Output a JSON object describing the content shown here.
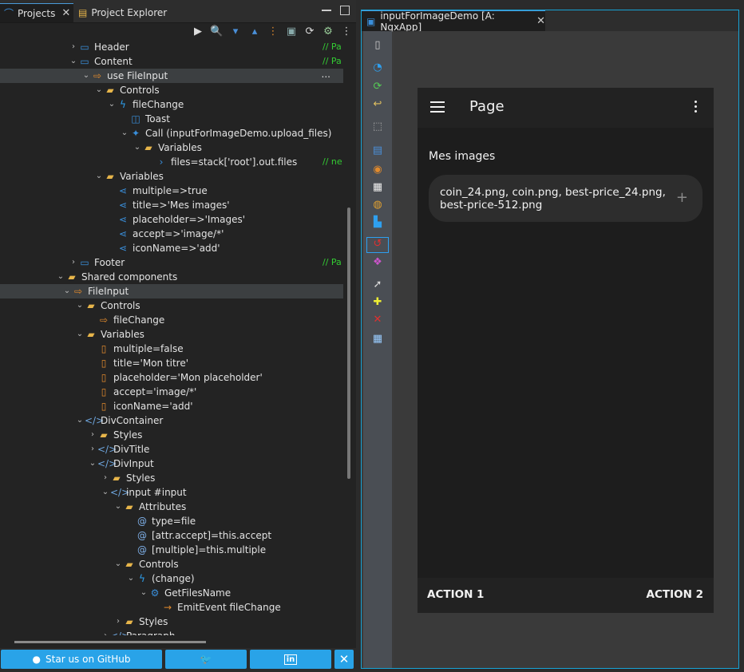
{
  "left_tabs": [
    {
      "label": "Projects",
      "active": true
    },
    {
      "label": "Project Explorer",
      "active": false
    }
  ],
  "tree": [
    {
      "indent": 0,
      "arrow": "›",
      "icon": "page-icon",
      "label": "Header",
      "comment": "// Pa"
    },
    {
      "indent": 0,
      "arrow": "⌄",
      "icon": "page-icon",
      "label": "Content",
      "comment": "// Pa"
    },
    {
      "indent": 1,
      "arrow": "⌄",
      "icon": "use-component-icon",
      "label": "use FileInput",
      "selected": true,
      "more": "..."
    },
    {
      "indent": 2,
      "arrow": "⌄",
      "icon": "folder-icon",
      "label": "Controls"
    },
    {
      "indent": 3,
      "arrow": "⌄",
      "icon": "event-icon",
      "label": "fileChange"
    },
    {
      "indent": 4,
      "arrow": "",
      "icon": "toast-icon",
      "label": "Toast"
    },
    {
      "indent": 4,
      "arrow": "⌄",
      "icon": "call-icon",
      "label": "Call (inputForImageDemo.upload_files)"
    },
    {
      "indent": 5,
      "arrow": "⌄",
      "icon": "folder-icon",
      "label": "Variables"
    },
    {
      "indent": 6,
      "arrow": "",
      "icon": "chevron-icon",
      "label": "files=stack['root'].out.files",
      "comment": "// ne"
    },
    {
      "indent": 2,
      "arrow": "⌄",
      "icon": "folder-icon",
      "label": "Variables"
    },
    {
      "indent": 3,
      "arrow": "",
      "icon": "share-icon",
      "label": "multiple=>true"
    },
    {
      "indent": 3,
      "arrow": "",
      "icon": "share-icon",
      "label": "title=>'Mes images'"
    },
    {
      "indent": 3,
      "arrow": "",
      "icon": "share-icon",
      "label": "placeholder=>'Images'"
    },
    {
      "indent": 3,
      "arrow": "",
      "icon": "share-icon",
      "label": "accept=>'image/*'"
    },
    {
      "indent": 3,
      "arrow": "",
      "icon": "share-icon",
      "label": "iconName=>'add'"
    },
    {
      "indent": 0,
      "arrow": "›",
      "icon": "page-icon",
      "label": "Footer",
      "comment": "// Pa"
    },
    {
      "indent": -1,
      "arrow": "⌄",
      "icon": "folder-icon",
      "label": "Shared components"
    },
    {
      "indent": -0.5,
      "arrow": "⌄",
      "icon": "component-icon",
      "label": "FileInput",
      "selected": true
    },
    {
      "indent": 0.5,
      "arrow": "⌄",
      "icon": "folder-icon",
      "label": "Controls"
    },
    {
      "indent": 1.5,
      "arrow": "",
      "icon": "event-out-icon",
      "label": "fileChange"
    },
    {
      "indent": 0.5,
      "arrow": "⌄",
      "icon": "folder-icon",
      "label": "Variables"
    },
    {
      "indent": 1.5,
      "arrow": "",
      "icon": "variable-icon",
      "label": "multiple=false"
    },
    {
      "indent": 1.5,
      "arrow": "",
      "icon": "variable-icon",
      "label": "title='Mon titre'"
    },
    {
      "indent": 1.5,
      "arrow": "",
      "icon": "variable-icon",
      "label": "placeholder='Mon placeholder'"
    },
    {
      "indent": 1.5,
      "arrow": "",
      "icon": "variable-icon",
      "label": "accept='image/*'"
    },
    {
      "indent": 1.5,
      "arrow": "",
      "icon": "variable-icon",
      "label": "iconName='add'"
    },
    {
      "indent": 0.5,
      "arrow": "⌄",
      "icon": "html-tag-icon",
      "label": "DivContainer"
    },
    {
      "indent": 1.5,
      "arrow": "›",
      "icon": "folder-icon",
      "label": "Styles"
    },
    {
      "indent": 1.5,
      "arrow": "›",
      "icon": "html-tag-icon",
      "label": "DivTitle"
    },
    {
      "indent": 1.5,
      "arrow": "⌄",
      "icon": "html-tag-icon",
      "label": "DivInput"
    },
    {
      "indent": 2.5,
      "arrow": "›",
      "icon": "folder-icon",
      "label": "Styles"
    },
    {
      "indent": 2.5,
      "arrow": "⌄",
      "icon": "html-tag-icon",
      "label": "input #input"
    },
    {
      "indent": 3.5,
      "arrow": "⌄",
      "icon": "folder-icon",
      "label": "Attributes"
    },
    {
      "indent": 4.5,
      "arrow": "",
      "icon": "attribute-icon",
      "label": "type=file"
    },
    {
      "indent": 4.5,
      "arrow": "",
      "icon": "attribute-icon",
      "label": "[attr.accept]=this.accept"
    },
    {
      "indent": 4.5,
      "arrow": "",
      "icon": "attribute-icon",
      "label": "[multiple]=this.multiple"
    },
    {
      "indent": 3.5,
      "arrow": "⌄",
      "icon": "folder-icon",
      "label": "Controls"
    },
    {
      "indent": 4.5,
      "arrow": "⌄",
      "icon": "event-icon",
      "label": "(change)"
    },
    {
      "indent": 5.5,
      "arrow": "⌄",
      "icon": "gear-icon",
      "label": "GetFilesName"
    },
    {
      "indent": 6.5,
      "arrow": "",
      "icon": "emit-icon",
      "label": "EmitEvent fileChange"
    },
    {
      "indent": 3.5,
      "arrow": "›",
      "icon": "folder-icon",
      "label": "Styles"
    },
    {
      "indent": 2.5,
      "arrow": "›",
      "icon": "html-tag-icon",
      "label": "Paragraph"
    }
  ],
  "social": {
    "github_label": "Star us on GitHub",
    "twitter_icon": "twitter-icon",
    "linkedin_icon": "linkedin-icon",
    "close_icon": "close-icon"
  },
  "editor_tab": {
    "label": "inputForImageDemo [A: NgxApp]"
  },
  "app": {
    "title": "Page",
    "section_label": "Mes images",
    "files_value": "coin_24.png, coin.png, best-price_24.png, best-price-512.png",
    "add_symbol": "+",
    "action1": "ACTION 1",
    "action2": "ACTION 2"
  },
  "colors": {
    "accent": "#29a3e8",
    "comment": "#33cc33",
    "folder": "#e7b54a"
  }
}
